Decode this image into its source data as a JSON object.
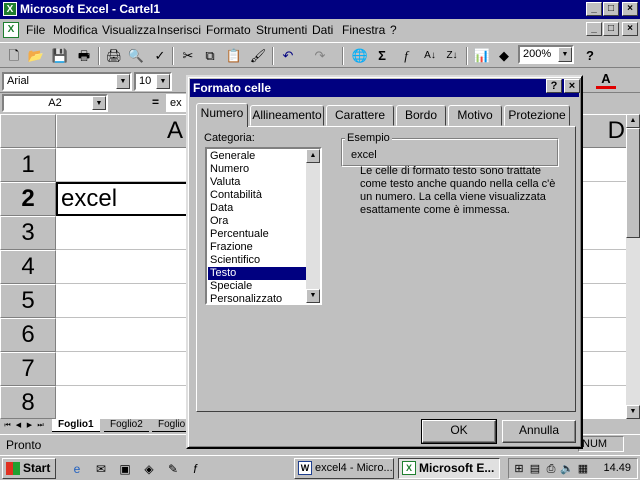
{
  "window": {
    "title": "Microsoft Excel - Cartel1",
    "min": "_",
    "max": "□",
    "close": "×"
  },
  "menu": {
    "items": [
      "File",
      "Modifica",
      "Visualizza",
      "Inserisci",
      "Formato",
      "Strumenti",
      "Dati",
      "Finestra",
      "?"
    ]
  },
  "toolbar": {
    "zoom": "200%",
    "font_name": "Arial",
    "font_size": "10",
    "sum": "Σ",
    "fx": "f",
    "sort_az": "A↓",
    "sort_za": "Z↓"
  },
  "formula_bar": {
    "name_box": "A2",
    "equals": "=",
    "value": "ex"
  },
  "sheet": {
    "columns": [
      "A",
      "D"
    ],
    "rows": [
      "1",
      "2",
      "3",
      "4",
      "5",
      "6",
      "7",
      "8"
    ],
    "selected_row": "2",
    "cell_a2": "excel",
    "tabs": [
      "Foglio1",
      "Foglio2",
      "Foglio"
    ],
    "active_tab": "Foglio1"
  },
  "status": {
    "text": "Pronto",
    "num": "NUM"
  },
  "taskbar": {
    "start": "Start",
    "items": [
      {
        "label": "excel4 - Micro...",
        "active": false
      },
      {
        "label": "Microsoft E...",
        "active": true
      }
    ],
    "clock": "14.49"
  },
  "dialog": {
    "title": "Formato celle",
    "help": "?",
    "close": "×",
    "tabs": [
      "Numero",
      "Allineamento",
      "Carattere",
      "Bordo",
      "Motivo",
      "Protezione"
    ],
    "active_tab": "Numero",
    "category_label": "Categoria:",
    "categories": [
      "Generale",
      "Numero",
      "Valuta",
      "Contabilità",
      "Data",
      "Ora",
      "Percentuale",
      "Frazione",
      "Scientifico",
      "Testo",
      "Speciale",
      "Personalizzato"
    ],
    "selected_category": "Testo",
    "sample_label": "Esempio",
    "sample_value": "excel",
    "description": "Le celle di formato testo sono trattate come testo anche quando nella cella c'è un numero. La cella viene visualizzata esattamente come è immessa.",
    "ok": "OK",
    "cancel": "Annulla"
  }
}
